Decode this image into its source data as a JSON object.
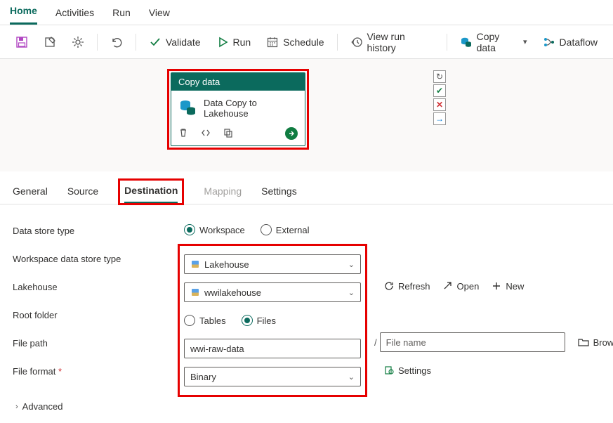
{
  "top_tabs": {
    "home": "Home",
    "activities": "Activities",
    "run": "Run",
    "view": "View"
  },
  "toolbar": {
    "validate": "Validate",
    "run": "Run",
    "schedule": "Schedule",
    "view_history": "View run history",
    "copy_data": "Copy data",
    "dataflow": "Dataflow"
  },
  "activity": {
    "title": "Copy data",
    "name": "Data Copy to Lakehouse"
  },
  "prop_tabs": {
    "general": "General",
    "source": "Source",
    "destination": "Destination",
    "mapping": "Mapping",
    "settings": "Settings"
  },
  "form": {
    "data_store_type_lbl": "Data store type",
    "workspace": "Workspace",
    "external": "External",
    "ws_type_lbl": "Workspace data store type",
    "ws_type_val": "Lakehouse",
    "lakehouse_lbl": "Lakehouse",
    "lakehouse_val": "wwilakehouse",
    "refresh": "Refresh",
    "open": "Open",
    "new": "New",
    "root_lbl": "Root folder",
    "tables": "Tables",
    "files": "Files",
    "filepath_lbl": "File path",
    "filepath_val": "wwi-raw-data",
    "filename_ph": "File name",
    "browse": "Browse",
    "format_lbl": "File format",
    "format_val": "Binary",
    "settings_link": "Settings",
    "advanced": "Advanced"
  }
}
